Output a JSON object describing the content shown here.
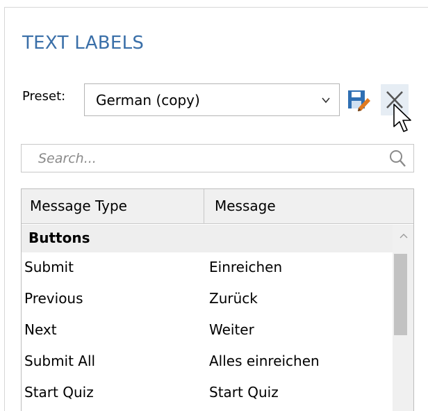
{
  "panel": {
    "title": "TEXT LABELS"
  },
  "preset": {
    "label": "Preset:",
    "selected": "German (copy)",
    "save_icon": "save-edit-icon",
    "delete_icon": "close-icon"
  },
  "search": {
    "placeholder": "Search...",
    "value": "",
    "icon": "magnifier-icon"
  },
  "table": {
    "columns": [
      "Message Type",
      "Message"
    ],
    "group": "Buttons",
    "rows": [
      {
        "type": "Submit",
        "message": "Einreichen"
      },
      {
        "type": "Previous",
        "message": "Zurück"
      },
      {
        "type": "Next",
        "message": "Weiter"
      },
      {
        "type": "Submit All",
        "message": "Alles einreichen"
      },
      {
        "type": "Start Quiz",
        "message": "Start Quiz"
      }
    ]
  },
  "colors": {
    "title": "#3a6fa8",
    "save_icon_blue": "#2f6fb3",
    "save_icon_orange": "#e07b22",
    "delete_button_bg": "#e6edf4"
  }
}
